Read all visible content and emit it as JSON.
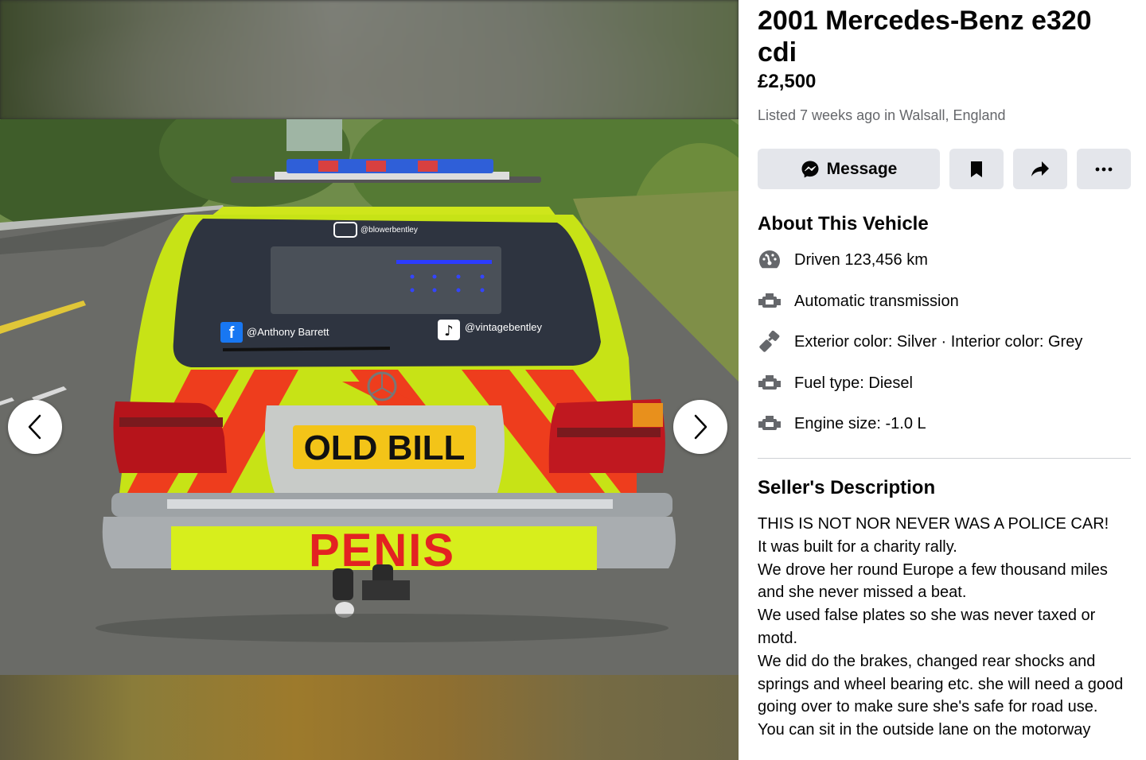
{
  "listing": {
    "title": "2001 Mercedes-Benz e320 cdi",
    "price": "£2,500",
    "listed": "Listed 7 weeks ago in Walsall, England"
  },
  "actions": {
    "message_label": "Message",
    "save_icon": "bookmark-icon",
    "share_icon": "share-icon",
    "more_icon": "more-icon"
  },
  "about": {
    "heading": "About This Vehicle",
    "specs": [
      {
        "icon": "speedometer-icon",
        "text": "Driven 123,456 km"
      },
      {
        "icon": "engine-icon",
        "text": "Automatic transmission"
      },
      {
        "icon": "paint-icon",
        "text": "Exterior color: Silver · Interior color: Grey"
      },
      {
        "icon": "engine-icon",
        "text": "Fuel type: Diesel"
      },
      {
        "icon": "engine-icon",
        "text": "Engine size: -1.0 L"
      }
    ]
  },
  "description": {
    "heading": "Seller's Description",
    "lines": [
      "THIS IS NOT NOR NEVER WAS A POLICE CAR!",
      "It was built for a charity rally.",
      "We drove her round Europe a few thousand miles and she never missed a beat.",
      "We used false plates so she was never taxed or motd.",
      "We did do the brakes, changed rear shocks and springs and wheel bearing etc. she will need a good going over to make sure she's safe for road use.",
      "You can sit in the outside lane on the motorway"
    ]
  },
  "photo": {
    "instagram_handle": "@blowerbentley",
    "facebook_handle": "@Anthony Barrett",
    "tiktok_handle": "@vintagebentley",
    "number_plate": "OLD BILL",
    "bumper_text": "PENIS"
  },
  "colors": {
    "hi_vis_yellow": "#cdea12",
    "chevron_red": "#ee3d1d",
    "button_grey": "#e4e6eb",
    "secondary_text": "#65676b"
  }
}
